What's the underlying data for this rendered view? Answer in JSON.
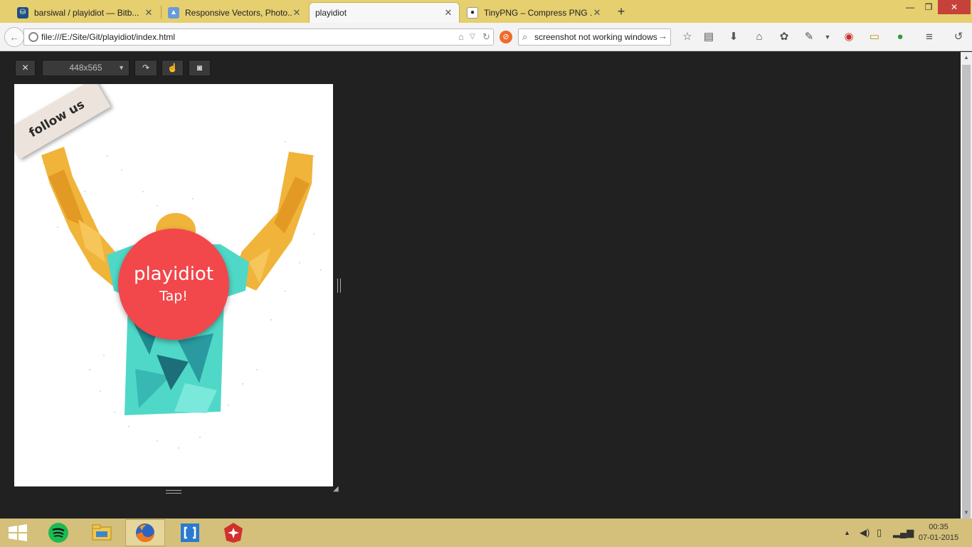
{
  "browser": {
    "tabs": [
      {
        "title": "barsiwal / playidiot — Bitb...",
        "active": false,
        "icon": "bitbucket-icon"
      },
      {
        "title": "Responsive Vectors, Photo...",
        "active": false,
        "icon": "image-icon"
      },
      {
        "title": "playidiot",
        "active": true,
        "icon": ""
      },
      {
        "title": "TinyPNG – Compress PNG ...",
        "active": false,
        "icon": "panda-icon"
      }
    ],
    "new_tab": "+",
    "window": {
      "minimize": "—",
      "restore": "❐",
      "close": "✕"
    },
    "url": "file:///E:/Site/Git/playidiot/index.html",
    "search_value": "screenshot not working windows"
  },
  "responsive_toolbar": {
    "close_label": "✕",
    "size_value": "448x565",
    "rotate_icon": "rotate-icon",
    "touch_icon": "touch-icon",
    "screenshot_icon": "camera-icon"
  },
  "page": {
    "ribbon_text": "follow us",
    "brand": "playidiot",
    "tap_label": "Tap!",
    "colors": {
      "circle": "#f2474b",
      "ribbon": "#ece4dc",
      "skin": "#f0b43a",
      "shirt": "#4fd8c7"
    }
  },
  "taskbar": {
    "apps": [
      "spotify-icon",
      "file-explorer-icon",
      "firefox-icon",
      "brackets-icon",
      "app-icon"
    ],
    "time": "00:35",
    "date": "07-01-2015"
  }
}
